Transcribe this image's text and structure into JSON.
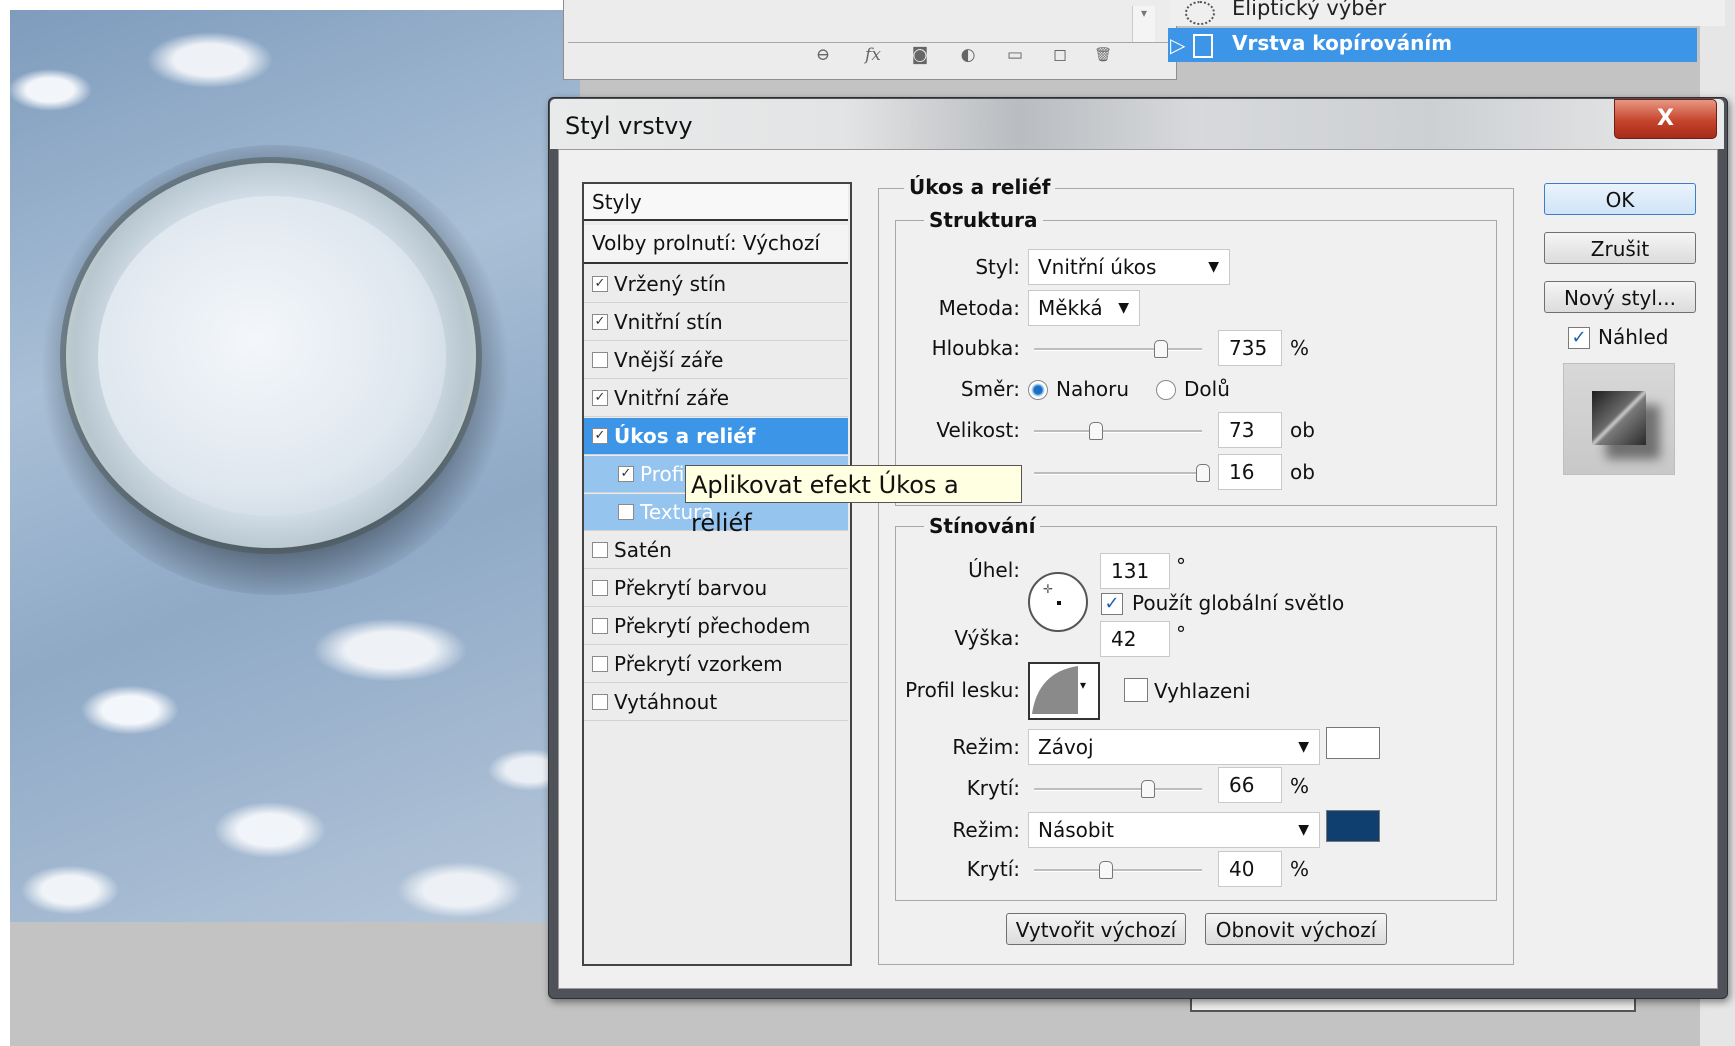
{
  "layers_panel": {
    "icons": [
      "link-icon",
      "fx-icon",
      "mask-icon",
      "adjustment-icon",
      "folder-icon",
      "new-layer-icon",
      "trash-icon"
    ],
    "icon_glyphs": [
      "⊖",
      "fx",
      "◙",
      "◐",
      "▭",
      "◻",
      "🗑"
    ],
    "layer_above_label": "Eliptický výběr",
    "selected_layer_label": "Vrstva kopírováním"
  },
  "dialog": {
    "title": "Styl vrstvy",
    "close_label": "X",
    "style_list": {
      "header": "Styly",
      "blend_options": "Volby prolnutí: Výchozí",
      "items": [
        {
          "label": "Vržený stín",
          "checked": true
        },
        {
          "label": "Vnitřní stín",
          "checked": true
        },
        {
          "label": "Vnější záře",
          "checked": false
        },
        {
          "label": "Vnitřní záře",
          "checked": true
        },
        {
          "label": "Úkos a reliéf",
          "checked": true
        },
        {
          "label": "Profil",
          "checked": true
        },
        {
          "label": "Textura",
          "checked": false
        },
        {
          "label": "Satén",
          "checked": false
        },
        {
          "label": "Překrytí barvou",
          "checked": false
        },
        {
          "label": "Překrytí přechodem",
          "checked": false
        },
        {
          "label": "Překrytí vzorkem",
          "checked": false
        },
        {
          "label": "Vytáhnout",
          "checked": false
        }
      ]
    },
    "tooltip": "Aplikovat efekt Úkos a reliéf",
    "bevel": {
      "title": "Úkos a reliéf",
      "structure": {
        "title": "Struktura",
        "style_label": "Styl:",
        "style_value": "Vnitřní úkos",
        "method_label": "Metoda:",
        "method_value": "Měkká",
        "depth_label": "Hloubka:",
        "depth_value": "735",
        "depth_unit": "%",
        "direction_label": "Směr:",
        "direction_up": "Nahoru",
        "direction_down": "Dolů",
        "direction_selected": "Nahoru",
        "size_label": "Velikost:",
        "size_value": "73",
        "size_unit": "ob",
        "soften_value": "16",
        "soften_unit": "ob"
      },
      "shading": {
        "title": "Stínování",
        "angle_label": "Úhel:",
        "angle_value": "131",
        "degree": "°",
        "global_light_label": "Použít globální světlo",
        "global_light_checked": true,
        "altitude_label": "Výška:",
        "altitude_value": "42",
        "gloss_label": "Profil lesku:",
        "antialias_label": "Vyhlazeni",
        "antialias_checked": false,
        "highlight_mode_label": "Režim:",
        "highlight_mode_value": "Závoj",
        "highlight_color": "#ffffff",
        "highlight_opacity_label": "Krytí:",
        "highlight_opacity_value": "66",
        "shadow_mode_label": "Režim:",
        "shadow_mode_value": "Násobit",
        "shadow_color": "#0e3f6e",
        "shadow_opacity_label": "Krytí:",
        "shadow_opacity_value": "40",
        "percent": "%"
      },
      "make_default": "Vytvořit výchozí",
      "reset_default": "Obnovit výchozí"
    },
    "buttons": {
      "ok": "OK",
      "cancel": "Zrušit",
      "new_style": "Nový styl...",
      "preview_label": "Náhled",
      "preview_checked": true
    },
    "slider_levels": {
      "depth": 0.74,
      "size": 0.34,
      "soften": 1.0,
      "highlight_opacity": 0.66,
      "shadow_opacity": 0.4
    }
  },
  "colors": {
    "selection_blue": "#3d95e8",
    "sub_selection_blue": "#95c4ef",
    "close_red": "#c6442c"
  }
}
